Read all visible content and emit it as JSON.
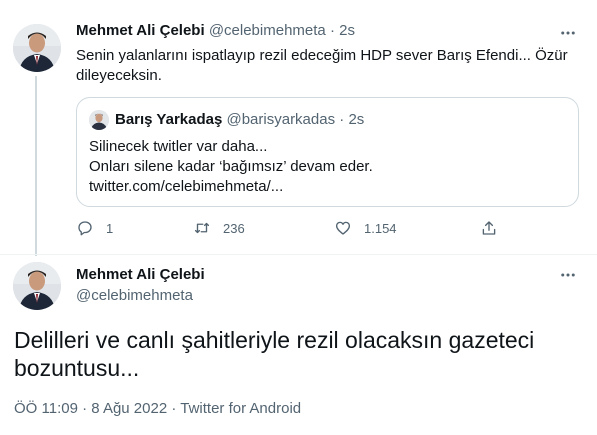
{
  "tweet": {
    "author_name": "Mehmet Ali Çelebi",
    "author_handle": "@celebimehmeta",
    "separator": "·",
    "time": "2s",
    "text": "Senin yalanlarını ispatlayıp rezil edeceğim HDP sever Barış Efendi... Özür dileyeceksin.",
    "quote": {
      "author_name": "Barış Yarkadaş",
      "author_handle": "@barisyarkadas",
      "separator": "·",
      "time": "2s",
      "lines": [
        "Silinecek twitler var daha...",
        "Onları silene kadar ‘bağımsız’ devam eder.",
        "twitter.com/celebimehmeta/..."
      ]
    },
    "actions": {
      "reply_count": "1",
      "retweet_count": "236",
      "like_count": "1.154"
    }
  },
  "main_tweet": {
    "author_name": "Mehmet Ali Çelebi",
    "author_handle": "@celebimehmeta",
    "text": "Delilleri ve canlı şahitleriyle rezil olacaksın gazeteci bozuntusu...",
    "timestamp": "ÖÖ 11:09 · 8 Ağu 2022 · ",
    "source": "Twitter for Android"
  },
  "icons": {
    "more": "more-horizontal-icon",
    "reply": "reply-icon",
    "retweet": "retweet-icon",
    "like": "heart-icon",
    "share": "share-icon"
  },
  "colors": {
    "text": "#0f1419",
    "secondary": "#536471",
    "border": "#cfd9de"
  }
}
